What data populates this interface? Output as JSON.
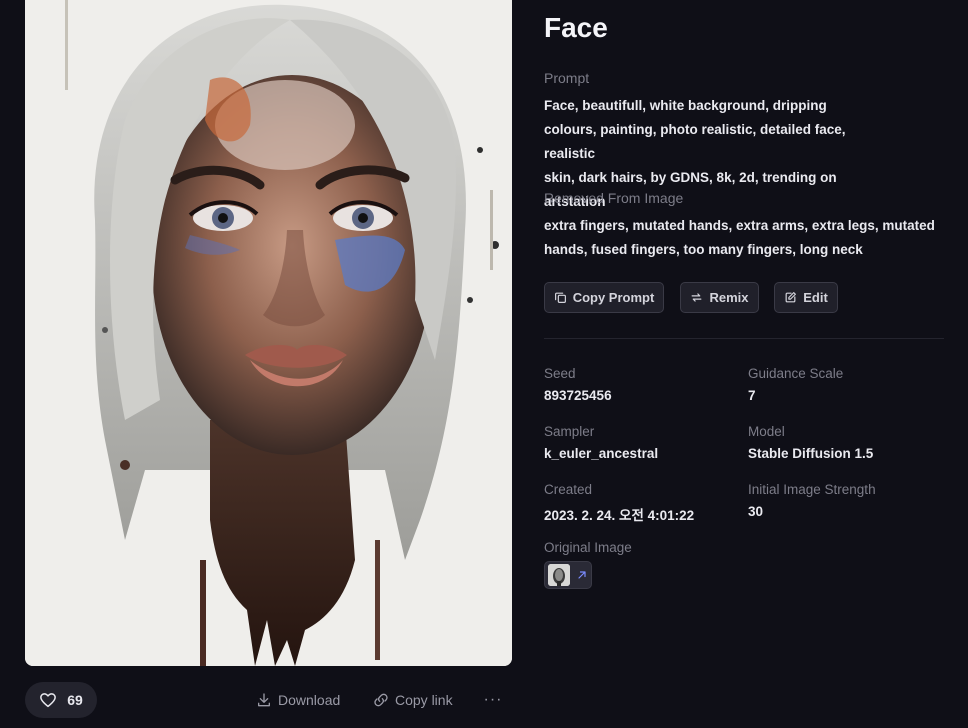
{
  "image": {
    "alt": "Face"
  },
  "actions": {
    "like_count": "69",
    "download_label": "Download",
    "copy_link_label": "Copy link",
    "more_label": "···"
  },
  "details": {
    "title": "Face",
    "prompt_label": "Prompt",
    "prompt_lines": [
      "Face, beautifull, white background, dripping",
      "colours, painting, photo realistic, detailed face, realistic",
      "skin, dark hairs, by GDNS, 8k, 2d, trending on artstation"
    ],
    "removed_label": "Removed From Image",
    "removed_lines": [
      "extra fingers, mutated hands, extra arms, extra legs, mutated",
      "hands, fused fingers, too many fingers, long neck"
    ],
    "buttons": {
      "copy_prompt": "Copy Prompt",
      "remix": "Remix",
      "edit": "Edit"
    },
    "meta": {
      "seed_label": "Seed",
      "seed": "893725456",
      "guidance_label": "Guidance Scale",
      "guidance": "7",
      "sampler_label": "Sampler",
      "sampler": "k_euler_ancestral",
      "model_label": "Model",
      "model": "Stable Diffusion 1.5",
      "created_label": "Created",
      "created": "2023. 2. 24. 오전 4:01:22",
      "strength_label": "Initial Image Strength",
      "strength": "30"
    },
    "original_image_label": "Original Image"
  },
  "colors": {
    "background": "#0f0f17",
    "surface": "#23232d",
    "muted_text": "#7d7d89",
    "link_arrow": "#7b8cff"
  }
}
